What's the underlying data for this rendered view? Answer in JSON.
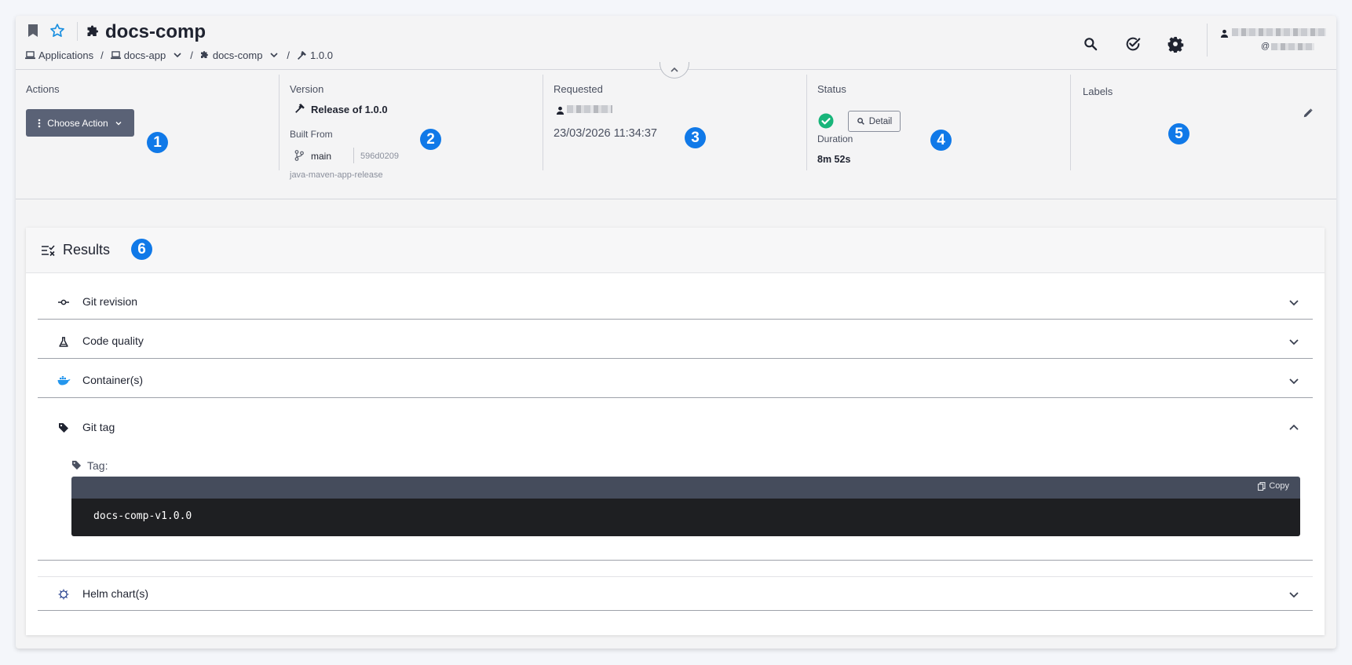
{
  "header": {
    "title": "docs-comp",
    "breadcrumbs": [
      {
        "label": "Applications",
        "icon": "laptop-icon"
      },
      {
        "label": "docs-app",
        "icon": "laptop-icon",
        "dropdown": true
      },
      {
        "label": "docs-comp",
        "icon": "puzzle-icon",
        "dropdown": true
      },
      {
        "label": "1.0.0",
        "icon": "hammer-icon"
      }
    ],
    "user_handle_prefix": "@"
  },
  "info": {
    "actions": {
      "label": "Actions",
      "button": "Choose Action",
      "badge": "1"
    },
    "version": {
      "label": "Version",
      "value": "Release of 1.0.0",
      "built_from_label": "Built From",
      "branch": "main",
      "commit": "596d0209",
      "pipeline": "java-maven-app-release",
      "badge": "2"
    },
    "requested": {
      "label": "Requested",
      "datetime": "23/03/2026 11:34:37",
      "badge": "3"
    },
    "status": {
      "label": "Status",
      "detail_button": "Detail",
      "duration_label": "Duration",
      "duration": "8m 52s",
      "badge": "4",
      "status_color": "#18b57a"
    },
    "labels": {
      "label": "Labels",
      "badge": "5"
    }
  },
  "results": {
    "title": "Results",
    "badge": "6",
    "sections": [
      {
        "label": "Git revision",
        "icon": "commit-icon",
        "expanded": false
      },
      {
        "label": "Code quality",
        "icon": "flask-icon",
        "expanded": false
      },
      {
        "label": "Container(s)",
        "icon": "docker-icon",
        "expanded": false
      },
      {
        "label": "Git tag",
        "icon": "tag-icon",
        "expanded": true
      },
      {
        "label": "Helm chart(s)",
        "icon": "helm-icon",
        "expanded": false
      }
    ],
    "git_tag": {
      "tag_label": "Tag:",
      "copy_label": "Copy",
      "value": "docs-comp-v1.0.0"
    }
  },
  "colors": {
    "accent_badge": "#1079e8",
    "button_bg": "#5a6276",
    "star": "#1a8fe0"
  }
}
